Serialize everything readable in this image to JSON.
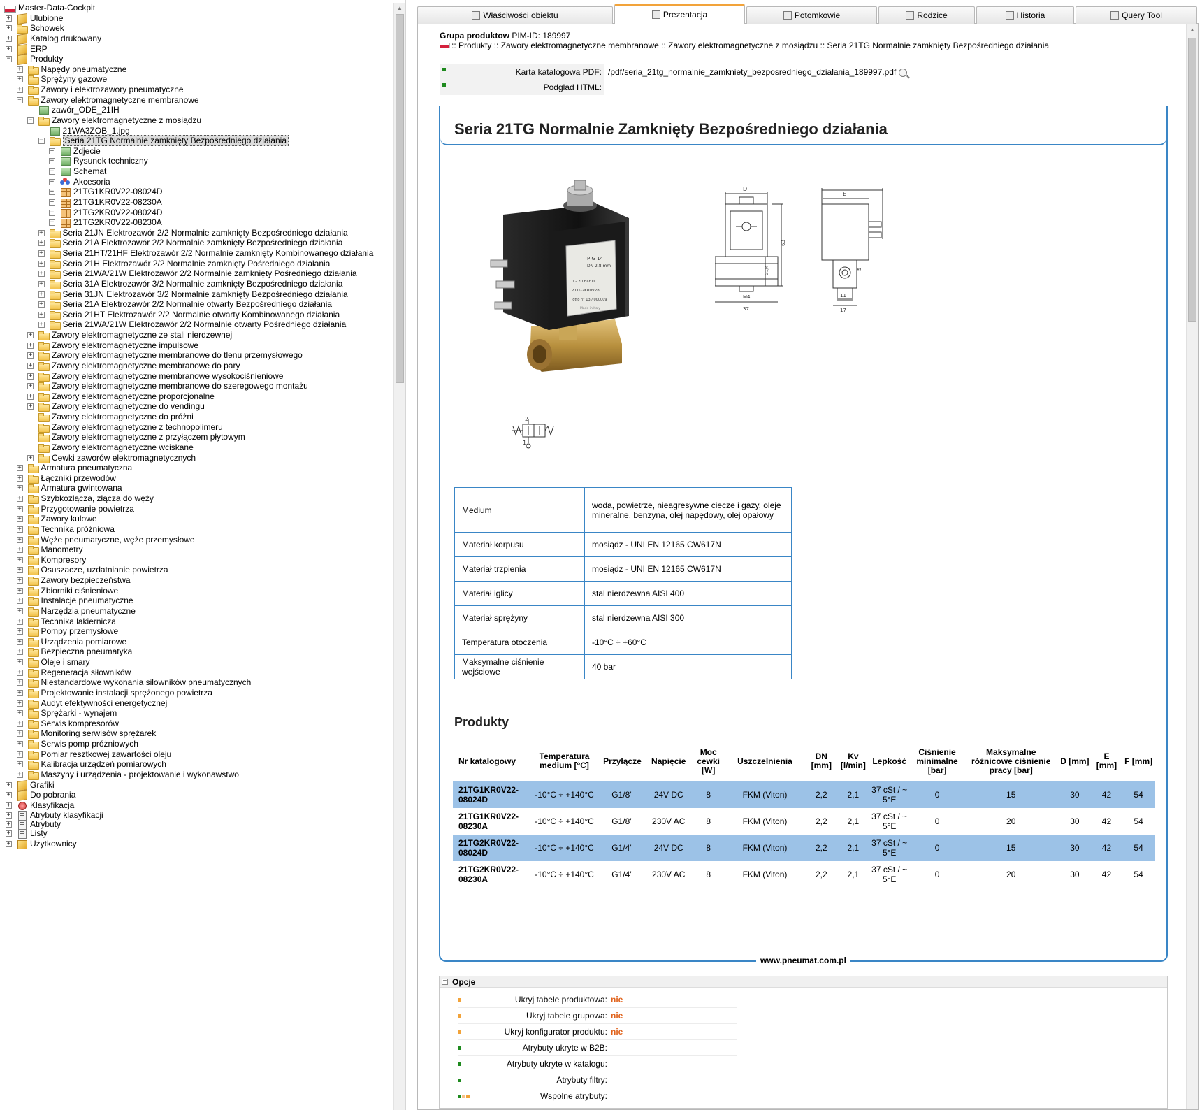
{
  "tree": {
    "items": [
      {
        "label": "Master-Data-Cockpit",
        "indent": 0,
        "icon": "flag-icon",
        "exp": ""
      },
      {
        "label": "Ulubione",
        "indent": 0,
        "icon": "cube-icon",
        "exp": "+"
      },
      {
        "label": "Schowek",
        "indent": 0,
        "icon": "folder-icon",
        "exp": "+"
      },
      {
        "label": "Katalog drukowany",
        "indent": 0,
        "icon": "cube-icon",
        "exp": "+"
      },
      {
        "label": "ERP",
        "indent": 0,
        "icon": "cube-icon",
        "exp": "+"
      },
      {
        "label": "Produkty",
        "indent": 0,
        "icon": "cube-icon",
        "exp": "-"
      },
      {
        "label": "Napędy pneumatyczne",
        "indent": 1,
        "icon": "folder-icon",
        "exp": "+"
      },
      {
        "label": "Sprężyny gazowe",
        "indent": 1,
        "icon": "folder-icon",
        "exp": "+"
      },
      {
        "label": "Zawory i elektrozawory pneumatyczne",
        "indent": 1,
        "icon": "folder-icon",
        "exp": "+"
      },
      {
        "label": "Zawory elektromagnetyczne membranowe",
        "indent": 1,
        "icon": "folder-icon",
        "exp": "-"
      },
      {
        "label": "zawór_ODE_21IH",
        "indent": 2,
        "icon": "image-icon",
        "exp": ""
      },
      {
        "label": "Zawory elektromagnetyczne z mosiądzu",
        "indent": 2,
        "icon": "folder-icon",
        "exp": "-"
      },
      {
        "label": "21WA3ZOB_1.jpg",
        "indent": 3,
        "icon": "image-icon",
        "exp": ""
      },
      {
        "label": "Seria 21TG Normalnie zamknięty Bezpośredniego działania",
        "indent": 3,
        "icon": "folder-grid-icon",
        "exp": "-",
        "selected": true
      },
      {
        "label": "Zdjecie",
        "indent": 4,
        "icon": "image-icon",
        "exp": "+"
      },
      {
        "label": "Rysunek techniczny",
        "indent": 4,
        "icon": "image-icon",
        "exp": "+"
      },
      {
        "label": "Schemat",
        "indent": 4,
        "icon": "image-icon",
        "exp": "+"
      },
      {
        "label": "Akcesoria",
        "indent": 4,
        "icon": "accessories-icon",
        "exp": "+"
      },
      {
        "label": "21TG1KR0V22-08024D",
        "indent": 4,
        "icon": "grid-icon",
        "exp": "+"
      },
      {
        "label": "21TG1KR0V22-08230A",
        "indent": 4,
        "icon": "grid-icon",
        "exp": "+"
      },
      {
        "label": "21TG2KR0V22-08024D",
        "indent": 4,
        "icon": "grid-icon",
        "exp": "+"
      },
      {
        "label": "21TG2KR0V22-08230A",
        "indent": 4,
        "icon": "grid-icon",
        "exp": "+"
      },
      {
        "label": "Seria 21JN Elektrozawór 2/2 Normalnie zamknięty Bezpośredniego działania",
        "indent": 3,
        "icon": "folder-grid-icon",
        "exp": "+"
      },
      {
        "label": "Seria 21A Elektrozawór 2/2 Normalnie zamknięty Bezpośredniego działania",
        "indent": 3,
        "icon": "folder-grid-icon",
        "exp": "+"
      },
      {
        "label": "Seria 21HT/21HF Elektrozawór 2/2 Normalnie zamknięty Kombinowanego działania",
        "indent": 3,
        "icon": "folder-grid-icon",
        "exp": "+"
      },
      {
        "label": "Seria 21H Elektrozawór 2/2 Normalnie zamknięty Pośredniego działania",
        "indent": 3,
        "icon": "folder-grid-icon",
        "exp": "+"
      },
      {
        "label": "Seria 21WA/21W Elektrozawór 2/2 Normalnie zamknięty Pośredniego działania",
        "indent": 3,
        "icon": "folder-grid-icon",
        "exp": "+"
      },
      {
        "label": "Seria 31A Elektrozawór 3/2 Normalnie zamknięty Bezpośredniego działania",
        "indent": 3,
        "icon": "folder-grid-icon",
        "exp": "+"
      },
      {
        "label": "Seria 31JN Elektrozawór 3/2 Normalnie zamknięty Bezpośredniego działania",
        "indent": 3,
        "icon": "folder-grid-icon",
        "exp": "+"
      },
      {
        "label": "Seria 21A Elektrozawór 2/2 Normalnie otwarty Bezpośredniego działania",
        "indent": 3,
        "icon": "folder-grid-icon",
        "exp": "+"
      },
      {
        "label": "Seria 21HT Elektrozawór 2/2 Normalnie otwarty Kombinowanego działania",
        "indent": 3,
        "icon": "folder-grid-icon",
        "exp": "+"
      },
      {
        "label": "Seria 21WA/21W Elektrozawór 2/2 Normalnie otwarty Pośredniego działania",
        "indent": 3,
        "icon": "folder-grid-icon",
        "exp": "+"
      },
      {
        "label": "Zawory elektromagnetyczne ze stali nierdzewnej",
        "indent": 2,
        "icon": "folder-icon",
        "exp": "+"
      },
      {
        "label": "Zawory elektromagnetyczne impulsowe",
        "indent": 2,
        "icon": "folder-icon",
        "exp": "+"
      },
      {
        "label": "Zawory elektromagnetyczne membranowe do tlenu przemysłowego",
        "indent": 2,
        "icon": "folder-icon",
        "exp": "+"
      },
      {
        "label": "Zawory elektromagnetyczne membranowe do pary",
        "indent": 2,
        "icon": "folder-icon",
        "exp": "+"
      },
      {
        "label": "Zawory elektromagnetyczne membranowe wysokociśnieniowe",
        "indent": 2,
        "icon": "folder-icon",
        "exp": "+"
      },
      {
        "label": "Zawory elektromagnetyczne membranowe do szeregowego montażu",
        "indent": 2,
        "icon": "folder-icon",
        "exp": "+"
      },
      {
        "label": "Zawory elektromagnetyczne proporcjonalne",
        "indent": 2,
        "icon": "folder-icon",
        "exp": "+"
      },
      {
        "label": "Zawory elektromagnetyczne do vendingu",
        "indent": 2,
        "icon": "folder-icon",
        "exp": "+"
      },
      {
        "label": "Zawory elektromagnetyczne do próżni",
        "indent": 2,
        "icon": "folder-icon",
        "exp": ""
      },
      {
        "label": "Zawory elektromagnetyczne z technopolimeru",
        "indent": 2,
        "icon": "folder-icon",
        "exp": ""
      },
      {
        "label": "Zawory elektromagnetyczne z przyłączem płytowym",
        "indent": 2,
        "icon": "folder-icon",
        "exp": ""
      },
      {
        "label": "Zawory elektromagnetyczne wciskane",
        "indent": 2,
        "icon": "folder-icon",
        "exp": ""
      },
      {
        "label": "Cewki zaworów elektromagnetycznych",
        "indent": 2,
        "icon": "folder-icon",
        "exp": "+"
      },
      {
        "label": "Armatura pneumatyczna",
        "indent": 1,
        "icon": "folder-icon",
        "exp": "+"
      },
      {
        "label": "Łączniki przewodów",
        "indent": 1,
        "icon": "folder-icon",
        "exp": "+"
      },
      {
        "label": "Armatura gwintowana",
        "indent": 1,
        "icon": "folder-icon",
        "exp": "+"
      },
      {
        "label": "Szybkozłącza, złącza do węży",
        "indent": 1,
        "icon": "folder-icon",
        "exp": "+"
      },
      {
        "label": "Przygotowanie powietrza",
        "indent": 1,
        "icon": "folder-icon",
        "exp": "+"
      },
      {
        "label": "Zawory kulowe",
        "indent": 1,
        "icon": "folder-icon",
        "exp": "+"
      },
      {
        "label": "Technika próżniowa",
        "indent": 1,
        "icon": "folder-icon",
        "exp": "+"
      },
      {
        "label": "Węże pneumatyczne, węże przemysłowe",
        "indent": 1,
        "icon": "folder-icon",
        "exp": "+"
      },
      {
        "label": "Manometry",
        "indent": 1,
        "icon": "folder-icon",
        "exp": "+"
      },
      {
        "label": "Kompresory",
        "indent": 1,
        "icon": "folder-icon",
        "exp": "+"
      },
      {
        "label": "Osuszacze, uzdatnianie powietrza",
        "indent": 1,
        "icon": "folder-icon",
        "exp": "+"
      },
      {
        "label": "Zawory bezpieczeństwa",
        "indent": 1,
        "icon": "folder-icon",
        "exp": "+"
      },
      {
        "label": "Zbiorniki ciśnieniowe",
        "indent": 1,
        "icon": "folder-icon",
        "exp": "+"
      },
      {
        "label": "Instalacje pneumatyczne",
        "indent": 1,
        "icon": "folder-icon",
        "exp": "+"
      },
      {
        "label": "Narzędzia pneumatyczne",
        "indent": 1,
        "icon": "folder-icon",
        "exp": "+"
      },
      {
        "label": "Technika lakiernicza",
        "indent": 1,
        "icon": "folder-icon",
        "exp": "+"
      },
      {
        "label": "Pompy przemysłowe",
        "indent": 1,
        "icon": "folder-icon",
        "exp": "+"
      },
      {
        "label": "Urządzenia pomiarowe",
        "indent": 1,
        "icon": "folder-icon",
        "exp": "+"
      },
      {
        "label": "Bezpieczna pneumatyka",
        "indent": 1,
        "icon": "folder-icon",
        "exp": "+"
      },
      {
        "label": "Oleje i smary",
        "indent": 1,
        "icon": "folder-icon",
        "exp": "+"
      },
      {
        "label": "Regeneracja siłowników",
        "indent": 1,
        "icon": "folder-icon",
        "exp": "+"
      },
      {
        "label": "Niestandardowe wykonania siłowników pneumatycznych",
        "indent": 1,
        "icon": "folder-icon",
        "exp": "+"
      },
      {
        "label": "Projektowanie instalacji sprężonego powietrza",
        "indent": 1,
        "icon": "folder-icon",
        "exp": "+"
      },
      {
        "label": "Audyt efektywności energetycznej",
        "indent": 1,
        "icon": "folder-icon",
        "exp": "+"
      },
      {
        "label": "Sprężarki - wynajem",
        "indent": 1,
        "icon": "folder-icon",
        "exp": "+"
      },
      {
        "label": "Serwis kompresorów",
        "indent": 1,
        "icon": "folder-icon",
        "exp": "+"
      },
      {
        "label": "Monitoring serwisów sprężarek",
        "indent": 1,
        "icon": "folder-icon",
        "exp": "+"
      },
      {
        "label": "Serwis pomp próżniowych",
        "indent": 1,
        "icon": "folder-icon",
        "exp": "+"
      },
      {
        "label": "Pomiar resztkowej zawartości oleju",
        "indent": 1,
        "icon": "folder-icon",
        "exp": "+"
      },
      {
        "label": "Kalibracja urządzeń pomiarowych",
        "indent": 1,
        "icon": "folder-icon",
        "exp": "+"
      },
      {
        "label": "Maszyny i urządzenia - projektowanie i wykonawstwo",
        "indent": 1,
        "icon": "folder-icon",
        "exp": "+"
      },
      {
        "label": "Grafiki",
        "indent": 0,
        "icon": "cube-icon",
        "exp": "+"
      },
      {
        "label": "Do pobrania",
        "indent": 0,
        "icon": "cube-icon",
        "exp": "+"
      },
      {
        "label": "Klasyfikacja",
        "indent": 0,
        "icon": "classification-icon",
        "exp": "+"
      },
      {
        "label": "Atrybuty klasyfikacji",
        "indent": 0,
        "icon": "list-icon",
        "exp": "+"
      },
      {
        "label": "Atrybuty",
        "indent": 0,
        "icon": "list-icon",
        "exp": "+"
      },
      {
        "label": "Listy",
        "indent": 0,
        "icon": "list-icon",
        "exp": "+"
      },
      {
        "label": "Użytkownicy",
        "indent": 0,
        "icon": "users-icon",
        "exp": "+"
      }
    ]
  },
  "tabs": [
    {
      "label": "Właściwości obiektu",
      "icon": "properties-icon",
      "active": false
    },
    {
      "label": "Prezentacja",
      "icon": "presentation-icon",
      "active": true
    },
    {
      "label": "Potomkowie",
      "icon": "descendants-icon",
      "active": false
    },
    {
      "label": "Rodzice",
      "icon": "parents-icon",
      "active": false
    },
    {
      "label": "Historia",
      "icon": "history-icon",
      "active": false
    },
    {
      "label": "Query Tool",
      "icon": "query-icon",
      "active": false
    }
  ],
  "header": {
    "group_label": "Grupa produktow",
    "pim_id": "PIM-ID: 189997",
    "breadcrumb": ":: Produkty :: Zawory elektromagnetyczne membranowe :: Zawory elektromagnetyczne z mosiądzu :: Seria 21TG Normalnie zamknięty Bezpośredniego działania"
  },
  "attributes": [
    {
      "label": "Karta katalogowa PDF:",
      "value": "/pdf/seria_21tg_normalnie_zamkniety_bezposredniego_dzialania_189997.pdf"
    },
    {
      "label": "Podglad HTML:",
      "value": ""
    }
  ],
  "presentation": {
    "title": "Seria 21TG Normalnie Zamknięty Bezpośredniego działania",
    "drawing_labels": {
      "d": "D",
      "e": "E",
      "dim63": "63",
      "dim37": "37",
      "dim17": "17",
      "dim11": "11",
      "dimM4": "M4",
      "dimG": "G1/4",
      "dim5": "5"
    },
    "symbol_labels": {
      "top": "2",
      "bottom": "1"
    },
    "photo_text": {
      "pg": "P G 14",
      "dn": "DN 2,8  mm",
      "pressure": "0 - 20 bar  DC",
      "code": "21TG2KR0V28",
      "lotto": "lotto n° 13 / 000009",
      "made": "Made in Italy"
    },
    "specs": [
      {
        "key": "Medium",
        "value": "woda, powietrze, nieagresywne ciecze i gazy, oleje mineralne, benzyna, olej napędowy, olej opałowy"
      },
      {
        "key": "Materiał korpusu",
        "value": "mosiądz - UNI EN 12165 CW617N"
      },
      {
        "key": "Materiał trzpienia",
        "value": "mosiądz - UNI EN 12165 CW617N"
      },
      {
        "key": "Materiał iglicy",
        "value": "stal nierdzewna AISI 400"
      },
      {
        "key": "Materiał sprężyny",
        "value": "stal nierdzewna AISI 300"
      },
      {
        "key": "Temperatura otoczenia",
        "value": "-10°C ÷ +60°C"
      },
      {
        "key": "Maksymalne ciśnienie wejściowe",
        "value": "40 bar"
      }
    ],
    "products_title": "Produkty",
    "product_columns": [
      "Nr katalogowy",
      "Temperatura medium [°C]",
      "Przyłącze",
      "Napięcie",
      "Moc cewki [W]",
      "Uszczelnienia",
      "DN [mm]",
      "Kv [l/min]",
      "Lepkość",
      "Ciśnienie minimalne [bar]",
      "Maksymalne różnicowe ciśnienie pracy [bar]",
      "D [mm]",
      "E [mm]",
      "F [mm]"
    ],
    "products": [
      {
        "nr": "21TG1KR0V22-08024D",
        "temp": "-10°C ÷ +140°C",
        "port": "G1/8\"",
        "voltage": "24V DC",
        "power": "8",
        "seal": "FKM (Viton)",
        "dn": "2,2",
        "kv": "2,1",
        "visc": "37 cSt / ~ 5°E",
        "pmin": "0",
        "pmax": "15",
        "d": "30",
        "e": "42",
        "f": "54"
      },
      {
        "nr": "21TG1KR0V22-08230A",
        "temp": "-10°C ÷ +140°C",
        "port": "G1/8\"",
        "voltage": "230V AC",
        "power": "8",
        "seal": "FKM (Viton)",
        "dn": "2,2",
        "kv": "2,1",
        "visc": "37 cSt / ~ 5°E",
        "pmin": "0",
        "pmax": "20",
        "d": "30",
        "e": "42",
        "f": "54"
      },
      {
        "nr": "21TG2KR0V22-08024D",
        "temp": "-10°C ÷ +140°C",
        "port": "G1/4\"",
        "voltage": "24V DC",
        "power": "8",
        "seal": "FKM (Viton)",
        "dn": "2,2",
        "kv": "2,1",
        "visc": "37 cSt / ~ 5°E",
        "pmin": "0",
        "pmax": "15",
        "d": "30",
        "e": "42",
        "f": "54"
      },
      {
        "nr": "21TG2KR0V22-08230A",
        "temp": "-10°C ÷ +140°C",
        "port": "G1/4\"",
        "voltage": "230V AC",
        "power": "8",
        "seal": "FKM (Viton)",
        "dn": "2,2",
        "kv": "2,1",
        "visc": "37 cSt / ~ 5°E",
        "pmin": "0",
        "pmax": "20",
        "d": "30",
        "e": "42",
        "f": "54"
      }
    ],
    "footer_url": "www.pneumat.com.pl"
  },
  "options": {
    "title": "Opcje",
    "rows": [
      {
        "label": "Ukryj tabele produktowa:",
        "value": "nie",
        "bullets": [
          "#f2a33a"
        ]
      },
      {
        "label": "Ukryj tabele grupowa:",
        "value": "nie",
        "bullets": [
          "#f2a33a"
        ]
      },
      {
        "label": "Ukryj konfigurator produktu:",
        "value": "nie",
        "bullets": [
          "#f2a33a"
        ]
      },
      {
        "label": "Atrybuty ukryte w B2B:",
        "value": "",
        "bullets": [
          "#1e8a1e"
        ]
      },
      {
        "label": "Atrybuty ukryte w katalogu:",
        "value": "",
        "bullets": [
          "#1e8a1e"
        ]
      },
      {
        "label": "Atrybuty filtry:",
        "value": "",
        "bullets": [
          "#1e8a1e"
        ]
      },
      {
        "label": "Wspolne atrybuty:",
        "value": "",
        "bullets": [
          "#1e8a1e",
          "#f6c28a",
          "#f2a33a"
        ]
      }
    ]
  },
  "colors": {
    "accent_blue": "#3a86c6",
    "row_highlight": "#9cc2e7",
    "tab_active_top": "#f2a33a",
    "option_value": "#e0621b"
  }
}
